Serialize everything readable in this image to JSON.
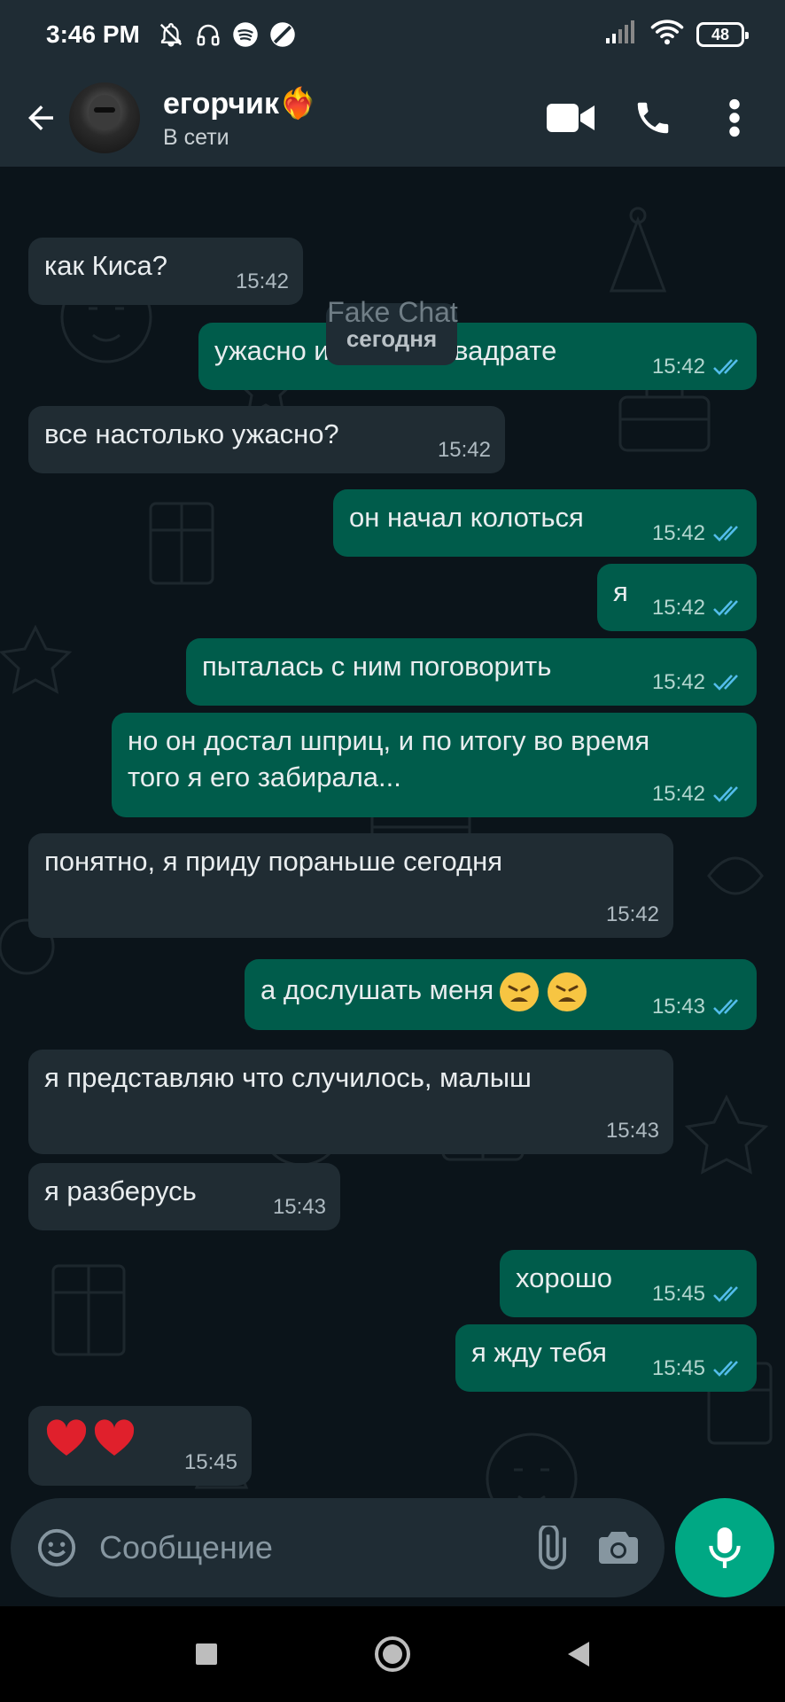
{
  "status_bar": {
    "time": "3:46 PM",
    "battery": "48",
    "icons": [
      "bell-off-icon",
      "headphones-icon",
      "spotify-icon",
      "blocked-icon",
      "signal-icon",
      "wifi-icon",
      "battery-icon"
    ]
  },
  "header": {
    "contact_name": "егорчик❤️‍🔥",
    "contact_status": "В сети",
    "icons": [
      "back-arrow-icon",
      "avatar",
      "video-call-icon",
      "phone-icon",
      "more-vert-icon"
    ]
  },
  "chat": {
    "watermark": "Fake Chat",
    "date_chip": "сегодня",
    "messages": [
      {
        "dir": "in",
        "text": "как Киса?",
        "time": "15:42"
      },
      {
        "dir": "out",
        "text": "ужасно и плохо в квадрате",
        "time": "15:42"
      },
      {
        "dir": "in",
        "text": "все настолько ужасно?",
        "time": "15:42"
      },
      {
        "dir": "out",
        "text": "он начал колоться",
        "time": "15:42"
      },
      {
        "dir": "out",
        "text": "я",
        "time": "15:42"
      },
      {
        "dir": "out",
        "text": "пыталась с ним поговорить",
        "time": "15:42"
      },
      {
        "dir": "out",
        "text_line1": "но он достал шприц, и по итогу во время",
        "text_line2": "того я его забирала...",
        "time": "15:42"
      },
      {
        "dir": "in",
        "text": "понятно, я приду пораньше сегодня",
        "time": "15:42"
      },
      {
        "dir": "out",
        "text": "а дослушать меня",
        "emoji": "😩😩",
        "time": "15:43"
      },
      {
        "dir": "in",
        "text": "я представляю что случилось, малыш",
        "time": "15:43"
      },
      {
        "dir": "in",
        "text": "я разберусь",
        "time": "15:43"
      },
      {
        "dir": "out",
        "text": "хорошо",
        "time": "15:45"
      },
      {
        "dir": "out",
        "text": "я жду тебя",
        "time": "15:45"
      },
      {
        "dir": "in",
        "emoji": "❤️❤️",
        "time": "15:45"
      }
    ]
  },
  "input": {
    "placeholder": "Сообщение",
    "icons": [
      "emoji-icon",
      "attach-icon",
      "camera-icon",
      "mic-icon"
    ]
  },
  "colors": {
    "background": "#0b141a",
    "bar": "#1f2c34",
    "incoming": "#202c33",
    "outgoing": "#005c4b",
    "accent": "#00a884",
    "read_tick": "#53bdeb"
  }
}
